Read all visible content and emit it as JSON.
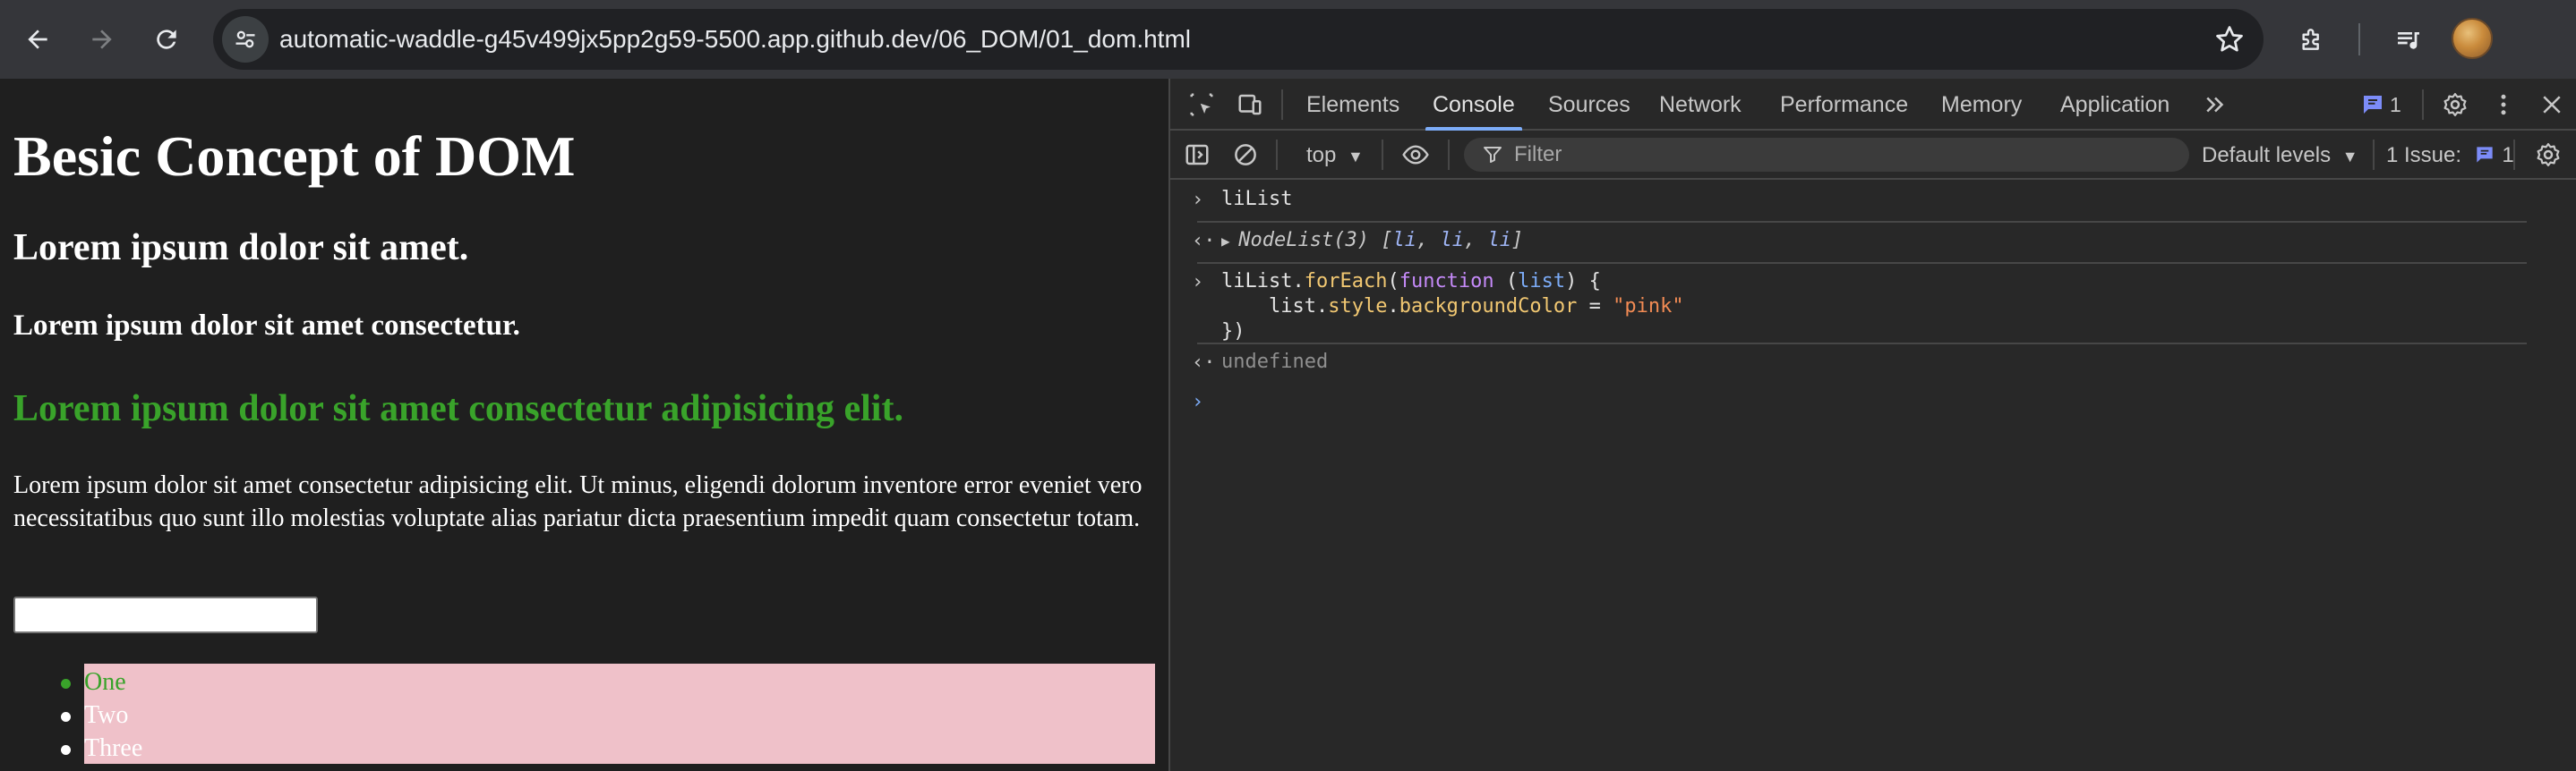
{
  "browser": {
    "url": "automatic-waddle-g45v499jx5pp2g59-5500.app.github.dev/06_DOM/01_dom.html"
  },
  "page": {
    "h1": "Besic Concept of DOM",
    "h2": "Lorem ipsum dolor sit amet.",
    "h3": "Lorem ipsum dolor sit amet consectetur.",
    "h2_green": "Lorem ipsum dolor sit amet consectetur adipisicing elit.",
    "paragraph": "Lorem ipsum dolor sit amet consectetur adipisicing elit. Ut minus, eligendi dolorum inventore error eveniet vero necessitatibus quo sunt illo molestias voluptate alias pariatur dicta praesentium impedit quam consectetur totam.",
    "input_value": "",
    "list": [
      "One",
      "Two",
      "Three"
    ],
    "colors": {
      "green": "#39a32a",
      "pink": "#efc1c9"
    }
  },
  "devtools": {
    "tabs": [
      "Elements",
      "Console",
      "Sources",
      "Network",
      "Performance",
      "Memory",
      "Application"
    ],
    "active_tab": "Console",
    "messages_badge": "1",
    "filterbar": {
      "context": "top",
      "filter_placeholder": "Filter",
      "levels": "Default levels",
      "issues_label": "1 Issue:",
      "issues_count": "1"
    },
    "console": {
      "input1": "liList",
      "output1": {
        "node": "NodeList(3)",
        "open": " [",
        "items": [
          "li",
          "li",
          "li"
        ],
        "close": "]"
      },
      "input2": {
        "line1_var": "liList",
        "line1_dot": ".",
        "line1_method": "forEach",
        "line1_open": "(",
        "line1_kw": "function",
        "line1_params_open": " (",
        "line1_param": "list",
        "line1_params_close": ") {",
        "line2_indent": "    ",
        "line2_obj": "list",
        "line2_dot1": ".",
        "line2_style": "style",
        "line2_dot2": ".",
        "line2_prop": "backgroundColor",
        "line2_eq": " = ",
        "line2_str": "\"pink\"",
        "line3": "})"
      },
      "output2": "undefined"
    }
  }
}
